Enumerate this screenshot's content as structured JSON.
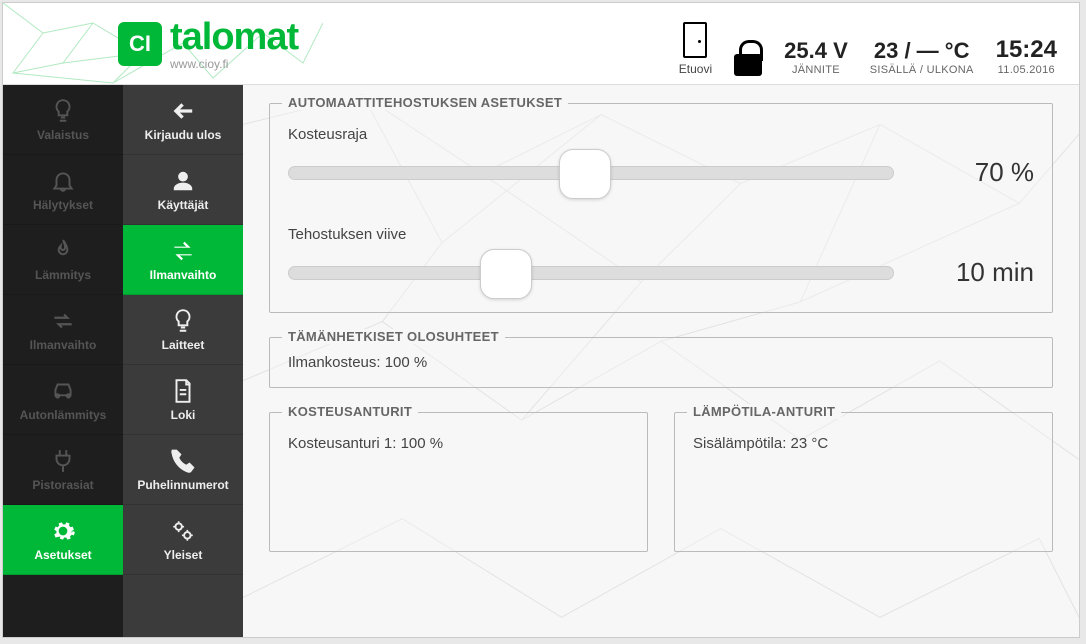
{
  "logo": {
    "badge": "CI",
    "text": "talomat",
    "url": "www.cioy.fi"
  },
  "header": {
    "door_label": "Etuovi",
    "voltage_value": "25.4 V",
    "voltage_label": "JÄNNITE",
    "temp_value": "23 / — °C",
    "temp_label": "SISÄLLÄ / ULKONA",
    "time_value": "15:24",
    "time_date": "11.05.2016"
  },
  "sidebar_left": [
    {
      "label": "Valaistus"
    },
    {
      "label": "Hälytykset"
    },
    {
      "label": "Lämmitys"
    },
    {
      "label": "Ilmanvaihto"
    },
    {
      "label": "Autonlämmitys"
    },
    {
      "label": "Pistorasiat"
    },
    {
      "label": "Asetukset",
      "active": true
    }
  ],
  "sidebar_right": [
    {
      "label": "Kirjaudu ulos"
    },
    {
      "label": "Käyttäjät"
    },
    {
      "label": "Ilmanvaihto",
      "active": true
    },
    {
      "label": "Laitteet"
    },
    {
      "label": "Loki"
    },
    {
      "label": "Puhelinnumerot"
    },
    {
      "label": "Yleiset"
    }
  ],
  "panels": {
    "auto": {
      "title": "AUTOMAATTITEHOSTUKSEN ASETUKSET",
      "humidity_label": "Kosteusraja",
      "humidity_value": "70 %",
      "humidity_pct": 49,
      "delay_label": "Tehostuksen viive",
      "delay_value": "10 min",
      "delay_pct": 36
    },
    "current": {
      "title": "TÄMÄNHETKISET OLOSUHTEET",
      "text": "Ilmankosteus: 100 %"
    },
    "humidity_sensors": {
      "title": "KOSTEUSANTURIT",
      "text": "Kosteusanturi 1: 100 %"
    },
    "temp_sensors": {
      "title": "LÄMPÖTILA-ANTURIT",
      "text": "Sisälämpötila: 23 °C"
    }
  }
}
